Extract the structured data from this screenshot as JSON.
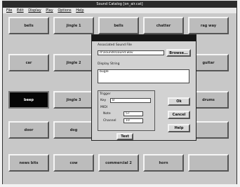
{
  "window": {
    "title": "Sound Catalog [on_air.cat]",
    "menu": [
      "File",
      "Edit",
      "Display",
      "Play",
      "Options",
      "Help"
    ]
  },
  "tiles": [
    {
      "label": "bells"
    },
    {
      "label": "jingle 1"
    },
    {
      "label": "bells"
    },
    {
      "label": "chatter"
    },
    {
      "label": "rag way"
    },
    {
      "label": "car"
    },
    {
      "label": "jingle 2"
    },
    {
      "label": ""
    },
    {
      "label": ""
    },
    {
      "label": "guitar"
    },
    {
      "label": "beep"
    },
    {
      "label": "jingle 3"
    },
    {
      "label": ""
    },
    {
      "label": ""
    },
    {
      "label": "drums"
    },
    {
      "label": "door"
    },
    {
      "label": "dog"
    },
    {
      "label": ""
    },
    {
      "label": ""
    },
    {
      "label": ""
    },
    {
      "label": "news bits"
    },
    {
      "label": "cow"
    },
    {
      "label": "commercial 2"
    },
    {
      "label": "horn"
    },
    {
      "label": ""
    }
  ],
  "dialog": {
    "associated_label": "Associated Sound File",
    "file_value": "d:\\sounds\\sound.wav",
    "browse_label": "Browse...",
    "display_label": "Display String",
    "display_value": "bugle",
    "trigger_label": "Trigger",
    "key_label": "Key",
    "key_value": "B",
    "midi_label": "MIDI",
    "note_label": "Note",
    "note_value": "57",
    "channel_label": "Channel",
    "channel_value": "10",
    "ok_label": "Ok",
    "cancel_label": "Cancel",
    "help_label": "Help",
    "test_label": "Test"
  }
}
